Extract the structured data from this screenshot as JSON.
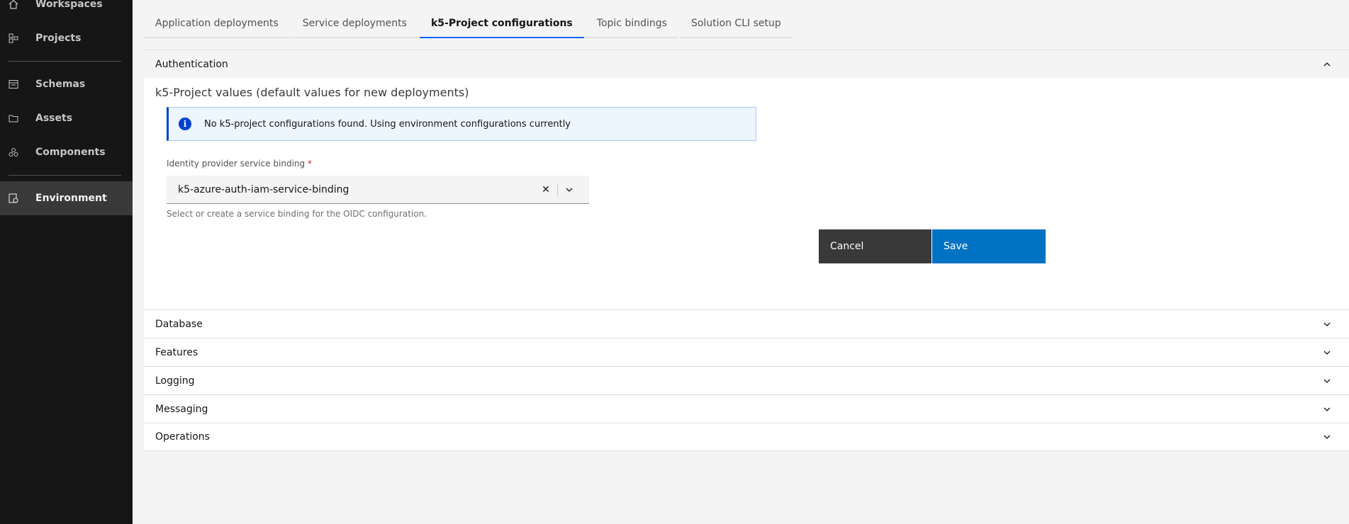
{
  "sidebar": {
    "items": [
      {
        "label": "Workspaces",
        "icon": "home-icon"
      },
      {
        "label": "Projects",
        "icon": "projects-icon"
      },
      {
        "label": "Schemas",
        "icon": "schemas-icon"
      },
      {
        "label": "Assets",
        "icon": "folder-icon"
      },
      {
        "label": "Components",
        "icon": "components-icon"
      },
      {
        "label": "Environment",
        "icon": "environment-icon",
        "active": true
      }
    ]
  },
  "tabs": [
    {
      "label": "Application deployments"
    },
    {
      "label": "Service deployments"
    },
    {
      "label": "k5-Project configurations",
      "active": true
    },
    {
      "label": "Topic bindings"
    },
    {
      "label": "Solution CLI setup"
    }
  ],
  "accordion": {
    "authentication": {
      "title": "Authentication",
      "panel_title": "k5-Project values (default values for new deployments)",
      "notice": "No k5-project configurations found. Using environment configurations currently",
      "field_label": "Identity provider service binding",
      "required_mark": "*",
      "field_value": "k5-azure-auth-iam-service-binding",
      "helper": "Select or create a service binding for the OIDC configuration.",
      "cancel_label": "Cancel",
      "save_label": "Save"
    },
    "sections": [
      {
        "title": "Database"
      },
      {
        "title": "Features"
      },
      {
        "title": "Logging"
      },
      {
        "title": "Messaging"
      },
      {
        "title": "Operations"
      }
    ]
  },
  "colors": {
    "sidebar_bg": "#161616",
    "active_nav_bg": "#393939",
    "tab_active_underline": "#0f62fe",
    "save_button": "#0072c3",
    "cancel_button": "#393939",
    "notice_bg": "#edf5ff"
  }
}
